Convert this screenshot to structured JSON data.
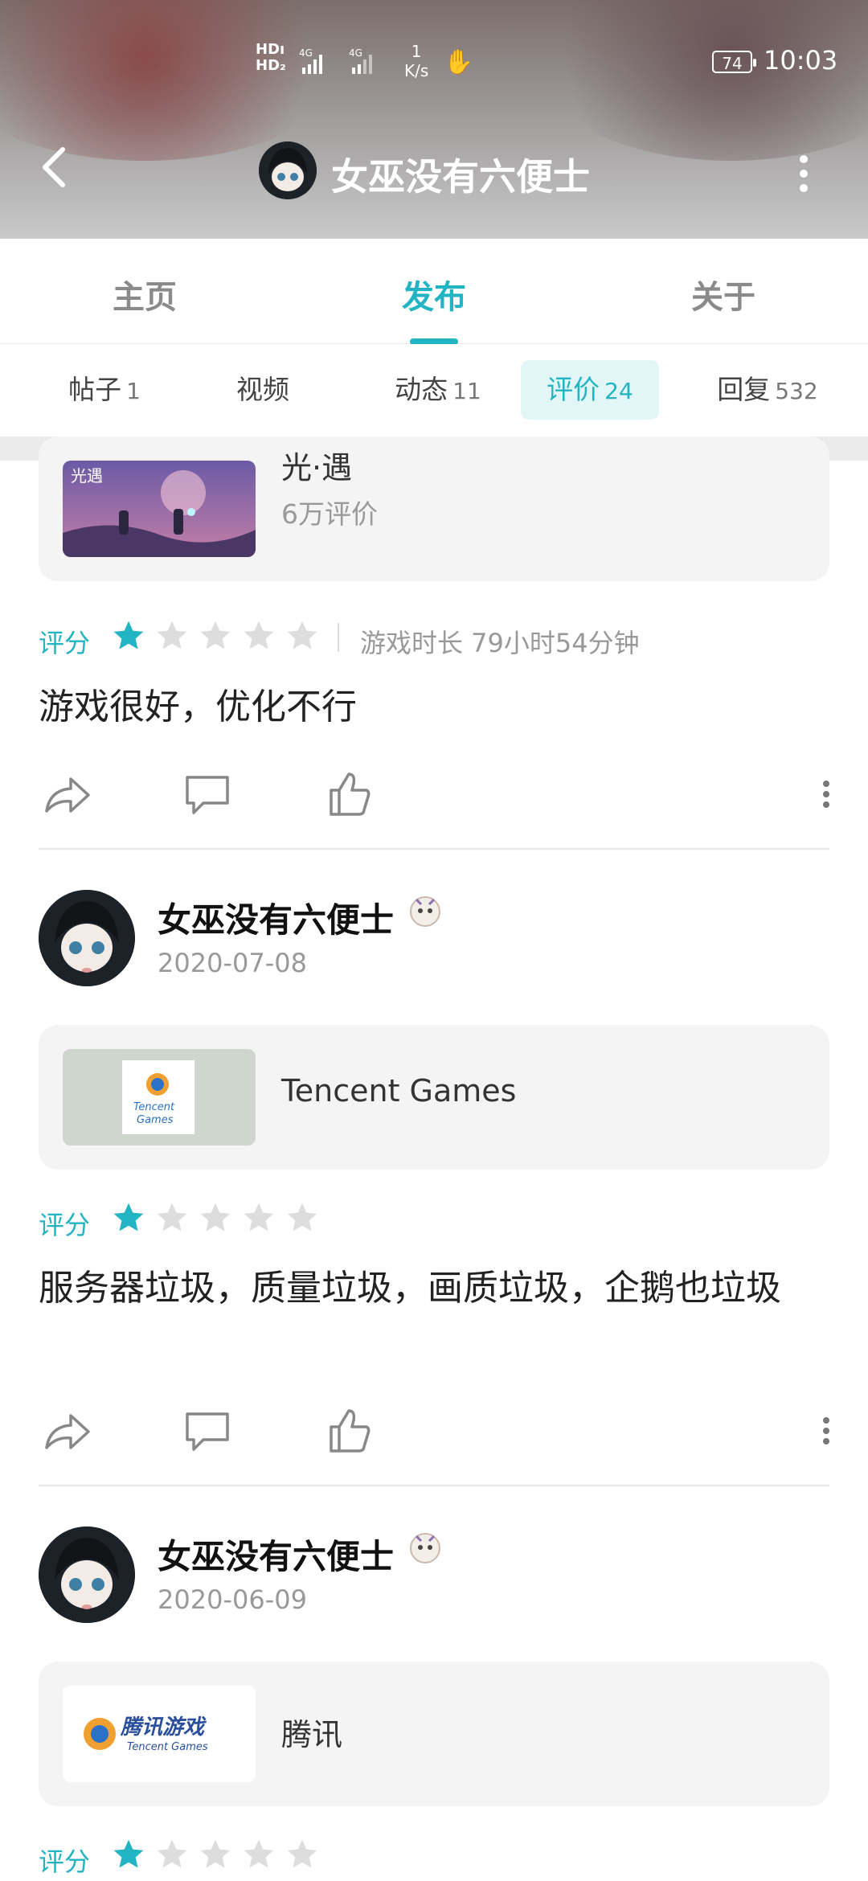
{
  "status_bar": {
    "network_1": "HD",
    "network_2": "HD",
    "sim1": "4G",
    "sim2": "4G",
    "speed_value": "1",
    "speed_unit": "K/s",
    "battery": "74",
    "time": "10:03"
  },
  "header": {
    "title": "女巫没有六便士"
  },
  "main_tabs": [
    {
      "label": "主页"
    },
    {
      "label": "发布"
    },
    {
      "label": "关于"
    }
  ],
  "sub_tabs": [
    {
      "label": "帖子",
      "count": "1"
    },
    {
      "label": "视频",
      "count": ""
    },
    {
      "label": "动态",
      "count": "11"
    },
    {
      "label": "评价",
      "count": "24"
    },
    {
      "label": "回复",
      "count": "532"
    }
  ],
  "reviews": [
    {
      "game_name": "光·遇",
      "game_sub": "6万评价",
      "rating_label": "评分",
      "stars": 1,
      "playtime": "游戏时长 79小时54分钟",
      "text": "游戏很好，优化不行"
    },
    {
      "user": "女巫没有六便士",
      "date": "2020-07-08",
      "game_name": "Tencent Games",
      "rating_label": "评分",
      "stars": 1,
      "text": "服务器垃圾，质量垃圾，画质垃圾，企鹅也垃圾"
    },
    {
      "user": "女巫没有六便士",
      "date": "2020-06-09",
      "game_name": "腾讯",
      "rating_label": "评分",
      "stars": 1
    }
  ],
  "colors": {
    "accent": "#23b4c4",
    "star_off": "#dddddd"
  }
}
